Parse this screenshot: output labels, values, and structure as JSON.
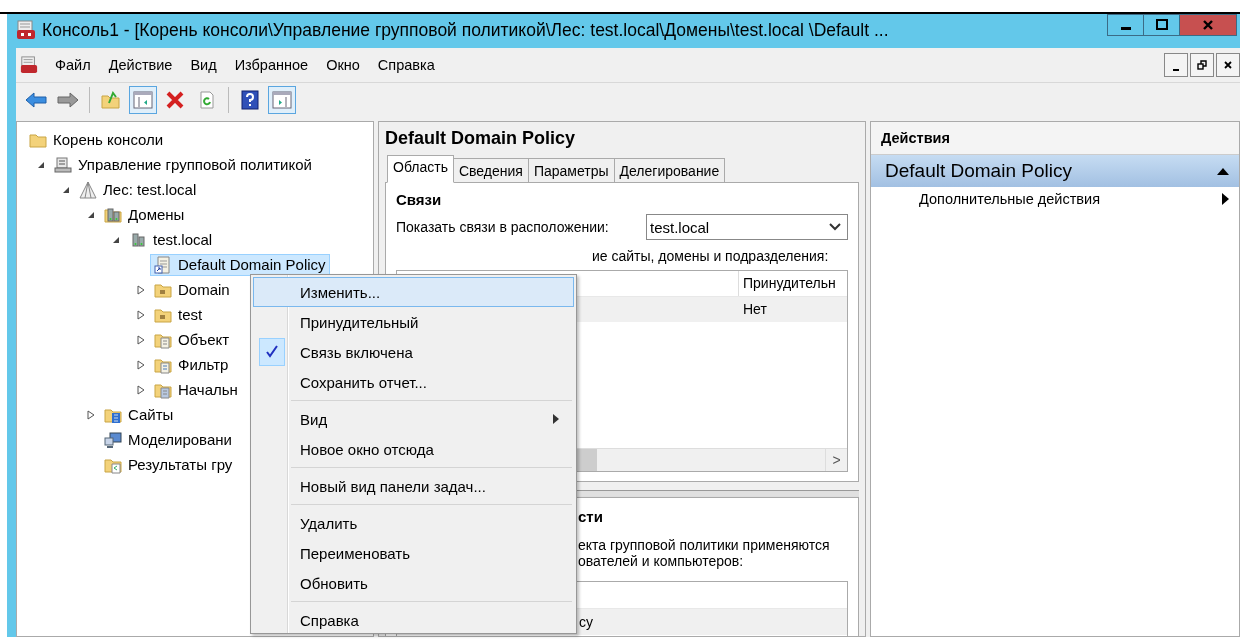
{
  "window": {
    "title": "Консоль1 - [Корень консоли\\Управление групповой политикой\\Лес: test.local\\Домены\\test.local \\Default ..."
  },
  "menu": [
    "Файл",
    "Действие",
    "Вид",
    "Избранное",
    "Окно",
    "Справка"
  ],
  "toolbar": [
    {
      "kind": "back",
      "pressed": false
    },
    {
      "kind": "forward",
      "pressed": false
    },
    {
      "kind": "sep"
    },
    {
      "kind": "up",
      "pressed": false
    },
    {
      "kind": "tree-pane",
      "pressed": true
    },
    {
      "kind": "delete",
      "pressed": false
    },
    {
      "kind": "refresh",
      "pressed": false
    },
    {
      "kind": "sep"
    },
    {
      "kind": "help",
      "pressed": false
    },
    {
      "kind": "action-pane",
      "pressed": true
    }
  ],
  "tree": [
    {
      "label": "Корень консоли",
      "kind": "folder",
      "selected": false,
      "children": [
        {
          "label": "Управление групповой политикой",
          "kind": "gpm",
          "expandable": true,
          "expanded": true,
          "selected": false,
          "children": [
            {
              "label": "Лес: test.local",
              "kind": "forest",
              "expandable": true,
              "expanded": true,
              "selected": false,
              "children": [
                {
                  "label": "Домены",
                  "kind": "domains",
                  "expandable": true,
                  "expanded": true,
                  "selected": false,
                  "children": [
                    {
                      "label": "test.local",
                      "kind": "domain",
                      "expandable": true,
                      "expanded": true,
                      "selected": false,
                      "children": [
                        {
                          "label": "Default Domain Policy",
                          "kind": "gpo-link",
                          "expandable": false,
                          "selected": true
                        },
                        {
                          "label": "Domain",
                          "kind": "ou",
                          "expandable": true,
                          "expanded": false,
                          "selected": false
                        },
                        {
                          "label": "test",
                          "kind": "ou",
                          "expandable": true,
                          "expanded": false,
                          "selected": false
                        },
                        {
                          "label": "Объект",
                          "kind": "gpo-folder",
                          "expandable": true,
                          "expanded": false,
                          "selected": false
                        },
                        {
                          "label": "Фильтр",
                          "kind": "filter-folder",
                          "expandable": true,
                          "expanded": false,
                          "selected": false
                        },
                        {
                          "label": "Начальн",
                          "kind": "starter-folder",
                          "expandable": true,
                          "expanded": false,
                          "selected": false
                        }
                      ]
                    }
                  ]
                },
                {
                  "label": "Сайты",
                  "kind": "sites",
                  "expandable": true,
                  "expanded": false,
                  "selected": false
                },
                {
                  "label": "Моделировани",
                  "kind": "modeling",
                  "expandable": false,
                  "selected": false
                },
                {
                  "label": "Результаты гру",
                  "kind": "results",
                  "expandable": false,
                  "selected": false
                }
              ]
            }
          ]
        }
      ]
    }
  ],
  "details": {
    "title": "Default Domain Policy",
    "tabs": [
      {
        "label": "Область",
        "selected": true
      },
      {
        "label": "Сведения",
        "selected": false
      },
      {
        "label": "Параметры",
        "selected": false
      },
      {
        "label": "Делегирование",
        "selected": false
      }
    ],
    "links_heading": "Связи",
    "location_label": "Показать связи в расположении:",
    "location_value": "test.local",
    "caption_partial": "ие сайты, домены и подразделения:",
    "links_table": {
      "column_2": "Принудительн",
      "rows": [
        {
          "column_2": "Нет"
        }
      ]
    },
    "scroll_arrow": ">",
    "filter_heading_partial": "сти",
    "filter_text_partial": [
      "екта групповой политики применяются",
      "ователей и компьютеров:"
    ],
    "filter_rows": [
      "cy"
    ]
  },
  "actions": {
    "title": "Действия",
    "sections": [
      {
        "title": "Default Domain Policy",
        "expanded": true,
        "items": [
          {
            "label": "Дополнительные действия",
            "submenu": true
          }
        ]
      }
    ]
  },
  "context_menu": [
    [
      {
        "label": "Изменить...",
        "selected": true,
        "checked": false,
        "submenu": false
      },
      {
        "label": "Принудительный",
        "selected": false,
        "checked": false,
        "submenu": false
      },
      {
        "label": "Связь включена",
        "selected": false,
        "checked": true,
        "submenu": false
      },
      {
        "label": "Сохранить отчет...",
        "selected": false,
        "checked": false,
        "submenu": false
      }
    ],
    [
      {
        "label": "Вид",
        "selected": false,
        "checked": false,
        "submenu": true
      },
      {
        "label": "Новое окно отсюда",
        "selected": false,
        "checked": false,
        "submenu": false
      }
    ],
    [
      {
        "label": "Новый вид панели задач...",
        "selected": false,
        "checked": false,
        "submenu": false
      }
    ],
    [
      {
        "label": "Удалить",
        "selected": false,
        "checked": false,
        "submenu": false
      },
      {
        "label": "Переименовать",
        "selected": false,
        "checked": false,
        "submenu": false
      },
      {
        "label": "Обновить",
        "selected": false,
        "checked": false,
        "submenu": false
      }
    ],
    [
      {
        "label": "Справка",
        "selected": false,
        "checked": false,
        "submenu": false
      }
    ]
  ]
}
